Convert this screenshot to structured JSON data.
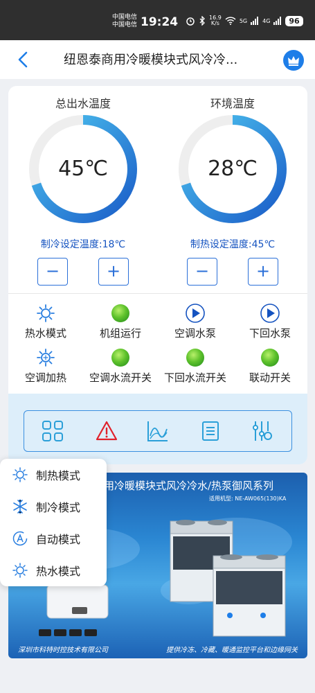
{
  "status_bar": {
    "carrier_1": "中国电信",
    "carrier_2": "中国电信",
    "time": "19:24",
    "speed_value": "16.9",
    "speed_unit": "K/s",
    "signal_1": "5G",
    "signal_2": "4G",
    "battery": "96"
  },
  "header": {
    "title": "纽恩泰商用冷暖模块式风冷冷...",
    "back_icon": "chevron-left-icon",
    "vip_icon": "crown-icon"
  },
  "gauges": [
    {
      "title": "总出水温度",
      "value": "45℃",
      "fill_fraction": 0.7,
      "setpoint": "制冷设定温度:18℃",
      "minus": "−",
      "plus": "+"
    },
    {
      "title": "环境温度",
      "value": "28℃",
      "fill_fraction": 0.7,
      "setpoint": "制热设定温度:45℃",
      "minus": "−",
      "plus": "+"
    }
  ],
  "status_items": [
    {
      "label": "热水模式",
      "icon": "sun-icon"
    },
    {
      "label": "机组运行",
      "icon": "green-indicator"
    },
    {
      "label": "空调水泵",
      "icon": "play-icon"
    },
    {
      "label": "下回水泵",
      "icon": "play-icon"
    },
    {
      "label": "空调加热",
      "icon": "snowflake-sun-icon"
    },
    {
      "label": "空调水流开关",
      "icon": "green-indicator"
    },
    {
      "label": "下回水流开关",
      "icon": "green-indicator"
    },
    {
      "label": "联动开关",
      "icon": "green-indicator"
    }
  ],
  "nav_icons": [
    "grid-icon",
    "alarm-icon",
    "chart-icon",
    "list-icon",
    "settings-sliders-icon"
  ],
  "banner": {
    "title": "用冷暖模块式风冷冷水/热泵御风系列",
    "model": "适用机型:  NE-AW065(130)KA",
    "footer_left": "深圳市科特时控技术有限公司",
    "footer_right": "提供冷冻、冷藏、暖通监控平台和边缘网关"
  },
  "mode_menu": [
    {
      "label": "制热模式",
      "icon": "sun-icon"
    },
    {
      "label": "制冷模式",
      "icon": "snowflake-icon"
    },
    {
      "label": "自动模式",
      "icon": "auto-icon"
    },
    {
      "label": "热水模式",
      "icon": "sun-icon"
    }
  ],
  "colors": {
    "accent": "#1e7ee8",
    "gauge_start": "#1a5cc8",
    "gauge_end": "#4fc7f0",
    "indicator_green": "#5fc22c",
    "alarm_red": "#e0212b"
  }
}
